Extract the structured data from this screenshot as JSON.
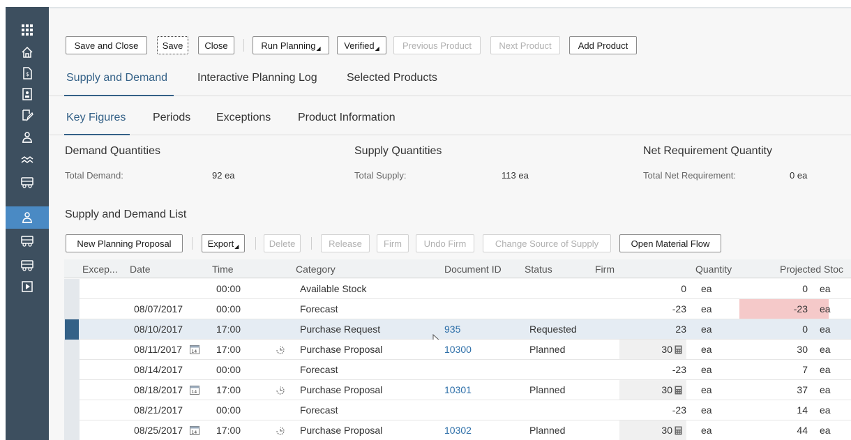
{
  "toolbar": {
    "save_close": "Save and Close",
    "save": "Save",
    "close": "Close",
    "run_planning": "Run Planning",
    "verified": "Verified",
    "previous_product": "Previous Product",
    "next_product": "Next Product",
    "add_product": "Add Product"
  },
  "main_tabs": [
    {
      "label": "Supply and Demand"
    },
    {
      "label": "Interactive Planning Log"
    },
    {
      "label": "Selected Products"
    }
  ],
  "sub_tabs": [
    {
      "label": "Key Figures"
    },
    {
      "label": "Periods"
    },
    {
      "label": "Exceptions"
    },
    {
      "label": "Product Information"
    }
  ],
  "key_figures": {
    "demand": {
      "title": "Demand Quantities",
      "label": "Total Demand:",
      "value": "92 ea"
    },
    "supply": {
      "title": "Supply Quantities",
      "label": "Total Supply:",
      "value": "113 ea"
    },
    "net": {
      "title": "Net Requirement Quantity",
      "label": "Total Net Requirement:",
      "value": "0 ea"
    }
  },
  "list": {
    "title": "Supply and Demand List",
    "buttons": {
      "new_proposal": "New Planning Proposal",
      "export": "Export",
      "delete": "Delete",
      "release": "Release",
      "firm": "Firm",
      "undo_firm": "Undo Firm",
      "change_source": "Change Source of Supply",
      "open_flow": "Open Material Flow"
    },
    "columns": {
      "exceptions": "Excep...",
      "date": "Date",
      "time": "Time",
      "category": "Category",
      "document_id": "Document ID",
      "status": "Status",
      "firm": "Firm",
      "quantity": "Quantity",
      "projected": "Projected Stoc"
    },
    "rows": [
      {
        "date": "",
        "time": "00:00",
        "category": "Available Stock",
        "doc": "",
        "status": "",
        "qty": "0",
        "qty_unit": "ea",
        "proj": "0",
        "proj_unit": "ea"
      },
      {
        "date": "08/07/2017",
        "time": "00:00",
        "category": "Forecast",
        "doc": "",
        "status": "",
        "qty": "-23",
        "qty_unit": "ea",
        "proj": "-23",
        "proj_unit": "ea"
      },
      {
        "date": "08/10/2017",
        "time": "17:00",
        "category": "Purchase Request",
        "doc": "935",
        "status": "Requested",
        "qty": "23",
        "qty_unit": "ea",
        "proj": "0",
        "proj_unit": "ea"
      },
      {
        "date": "08/11/2017",
        "time": "17:00",
        "category": "Purchase Proposal",
        "doc": "10300",
        "status": "Planned",
        "qty": "30",
        "qty_unit": "ea",
        "proj": "30",
        "proj_unit": "ea"
      },
      {
        "date": "08/14/2017",
        "time": "00:00",
        "category": "Forecast",
        "doc": "",
        "status": "",
        "qty": "-23",
        "qty_unit": "ea",
        "proj": "7",
        "proj_unit": "ea"
      },
      {
        "date": "08/18/2017",
        "time": "17:00",
        "category": "Purchase Proposal",
        "doc": "10301",
        "status": "Planned",
        "qty": "30",
        "qty_unit": "ea",
        "proj": "37",
        "proj_unit": "ea"
      },
      {
        "date": "08/21/2017",
        "time": "00:00",
        "category": "Forecast",
        "doc": "",
        "status": "",
        "qty": "-23",
        "qty_unit": "ea",
        "proj": "14",
        "proj_unit": "ea"
      },
      {
        "date": "08/25/2017",
        "time": "17:00",
        "category": "Purchase Proposal",
        "doc": "10302",
        "status": "Planned",
        "qty": "30",
        "qty_unit": "ea",
        "proj": "44",
        "proj_unit": "ea"
      }
    ]
  },
  "calendar_icon_text": "14",
  "colors": {
    "nav_bg": "#3d4f5f",
    "nav_active": "#4a8ac4",
    "accent": "#346187",
    "link": "#2c6ea8",
    "negative_bg": "#f5c9c9"
  },
  "nav_icons": [
    "apps-grid-icon",
    "home-icon",
    "document-dollar-icon",
    "contact-card-icon",
    "edit-document-icon",
    "planner-icon",
    "trend-icon",
    "truck-icon",
    "planner-active-icon",
    "truck-icon-2",
    "truck-icon-3",
    "play-icon"
  ]
}
